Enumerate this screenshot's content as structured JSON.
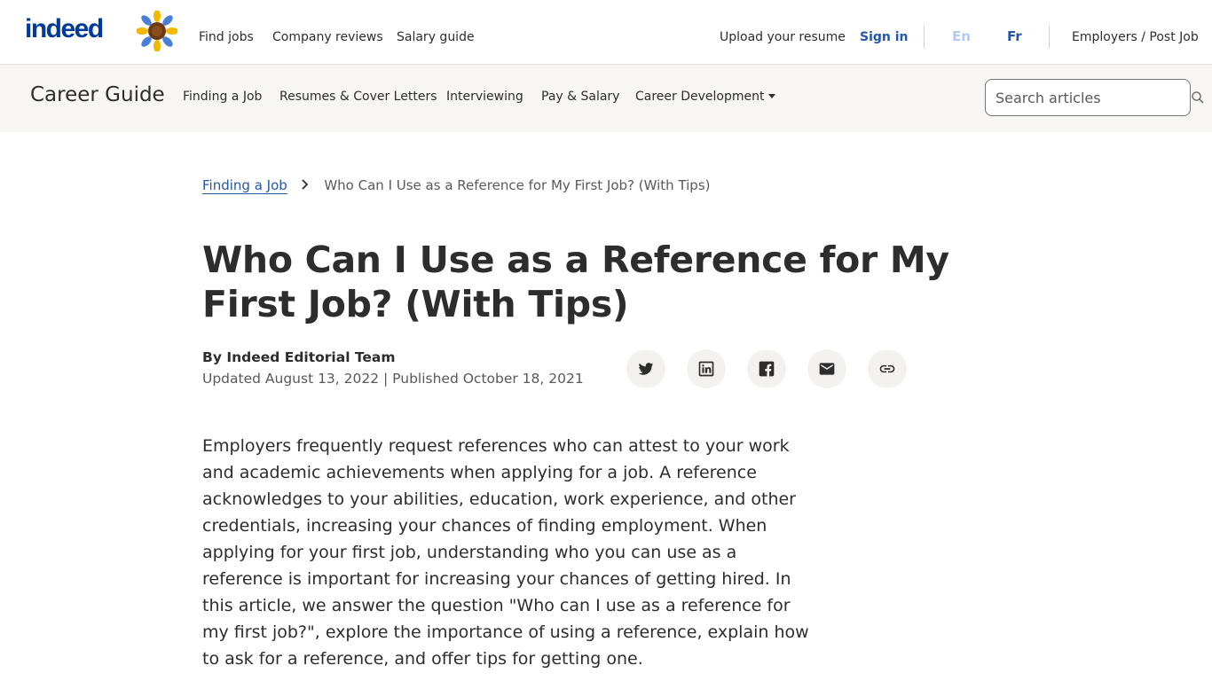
{
  "topnav": {
    "logo": "indeed",
    "links": [
      "Find jobs",
      "Company reviews",
      "Salary guide"
    ],
    "upload_resume": "Upload your resume",
    "sign_in": "Sign in",
    "lang_en": "En",
    "lang_fr": "Fr",
    "employers": "Employers / Post Job"
  },
  "guidebar": {
    "title": "Career Guide",
    "categories": [
      "Finding a Job",
      "Resumes & Cover Letters",
      "Interviewing",
      "Pay & Salary",
      "Career Development"
    ],
    "search_placeholder": "Search articles"
  },
  "breadcrumb": {
    "parent": "Finding a Job",
    "current": "Who Can I Use as a Reference for My First Job? (With Tips)"
  },
  "article": {
    "title": "Who Can I Use as a Reference for My First Job? (With Tips)",
    "author": "By Indeed Editorial Team",
    "dates": "Updated August 13, 2022 | Published October 18, 2021",
    "share_icons": [
      "twitter-icon",
      "linkedin-icon",
      "facebook-icon",
      "email-icon",
      "link-icon"
    ],
    "body": "Employers frequently request references who can attest to your work and academic achievements when applying for a job. A reference acknowledges to your abilities, education, work experience, and other credentials, increasing your chances of finding employment. When applying for your first job, understanding who you can use as a reference is important for increasing your chances of getting hired. In this article, we answer the question \"Who can I use as a reference for my first job?\", explore the importance of using a reference, explain how to ask for a reference, and offer tips for getting one."
  },
  "colors": {
    "brand_blue": "#2557a7",
    "logo_blue": "#003a9b",
    "text": "#2d2d2d",
    "muted": "#595959",
    "guidebar_bg": "#f7f6f5"
  }
}
